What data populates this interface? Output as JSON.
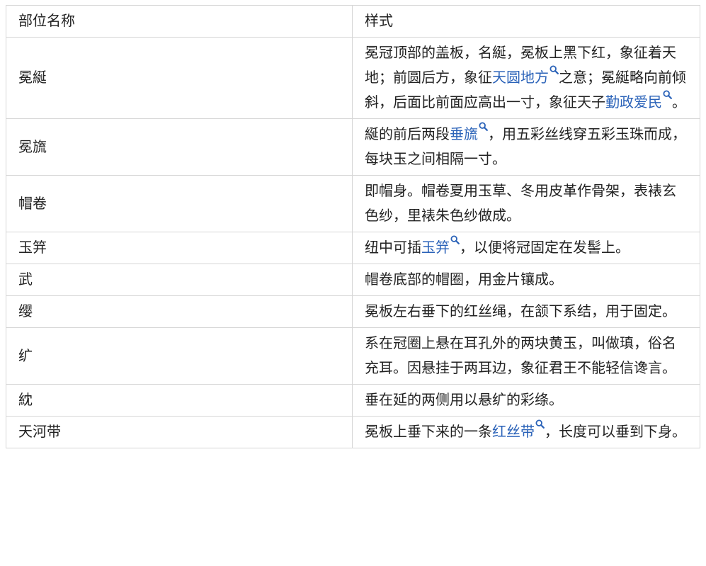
{
  "table": {
    "headers": [
      "部位名称",
      "样式"
    ],
    "rows": [
      {
        "name": "冕綖",
        "parts": [
          {
            "t": "冕冠顶部的盖板，名綖，冕板上黑下红，象征着天地；前圆后方，象征"
          },
          {
            "t": "天圆地方",
            "link": true
          },
          {
            "t": "之意；冕綖略向前倾斜，后面比前面应高出一寸，象征天子"
          },
          {
            "t": "勤政爱民",
            "link": true
          },
          {
            "t": "。"
          }
        ]
      },
      {
        "name": "冕旒",
        "parts": [
          {
            "t": "綖的前后两段"
          },
          {
            "t": "垂旒",
            "link": true
          },
          {
            "t": "，用五彩丝线穿五彩玉珠而成，每块玉之间相隔一寸。"
          }
        ]
      },
      {
        "name": "帽卷",
        "parts": [
          {
            "t": "即帽身。帽卷夏用玉草、冬用皮革作骨架，表裱玄色纱，里裱朱色纱做成。"
          }
        ]
      },
      {
        "name": "玉笄",
        "parts": [
          {
            "t": "纽中可插"
          },
          {
            "t": "玉笄",
            "link": true
          },
          {
            "t": "，以便将冠固定在发髻上。"
          }
        ]
      },
      {
        "name": "武",
        "parts": [
          {
            "t": "帽卷底部的帽圈，用金片镶成。"
          }
        ]
      },
      {
        "name": "缨",
        "parts": [
          {
            "t": "冕板左右垂下的红丝绳，在颔下系结，用于固定。"
          }
        ]
      },
      {
        "name": "纩",
        "parts": [
          {
            "t": "系在冠圈上悬在耳孔外的两块黄玉，叫做瑱，俗名充耳。因悬挂于两耳边，象征君王不能轻信谗言。"
          }
        ]
      },
      {
        "name": "紞",
        "parts": [
          {
            "t": "垂在延的两侧用以悬纩的彩绦。"
          }
        ]
      },
      {
        "name": "天河带",
        "parts": [
          {
            "t": "冕板上垂下来的一条"
          },
          {
            "t": "红丝带",
            "link": true
          },
          {
            "t": "，长度可以垂到下身。"
          }
        ]
      }
    ]
  },
  "colors": {
    "link": "#2a62b8",
    "border": "#d6d6d6",
    "text": "#222222"
  },
  "icons": {
    "link_suffix": "search-icon"
  }
}
